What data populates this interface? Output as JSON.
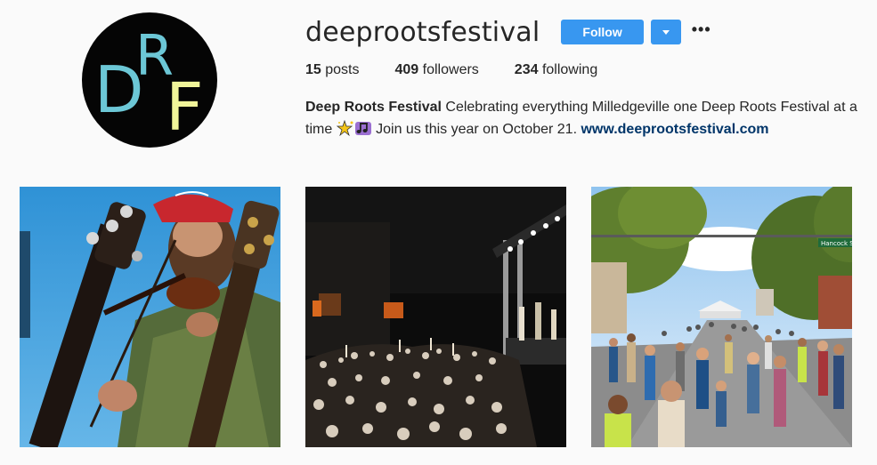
{
  "profile": {
    "username": "deeprootsfestival",
    "follow_label": "Follow",
    "avatar_icon": "drf-logo",
    "logo_letters": {
      "d": "D",
      "r": "R",
      "f": "F"
    },
    "stats": {
      "posts_count": "15",
      "posts_label": "posts",
      "followers_count": "409",
      "followers_label": "followers",
      "following_count": "234",
      "following_label": "following"
    },
    "bio": {
      "name": "Deep Roots Festival",
      "text_1": " Celebrating everything Milledgeville one Deep Roots Festival at a time ",
      "text_2": " Join us this year on October 21. ",
      "link": "www.deeprootsfestival.com"
    }
  },
  "colors": {
    "accent": "#3897f0",
    "logo_teal": "#6cc7d6",
    "logo_yellow": "#f1f59a",
    "link": "#003569"
  },
  "posts": [
    {
      "subject": "fiddle-player-photo"
    },
    {
      "subject": "concert-crowd-photo",
      "sign_text": ""
    },
    {
      "subject": "street-festival-photo",
      "street_sign": "Hancock St"
    }
  ]
}
